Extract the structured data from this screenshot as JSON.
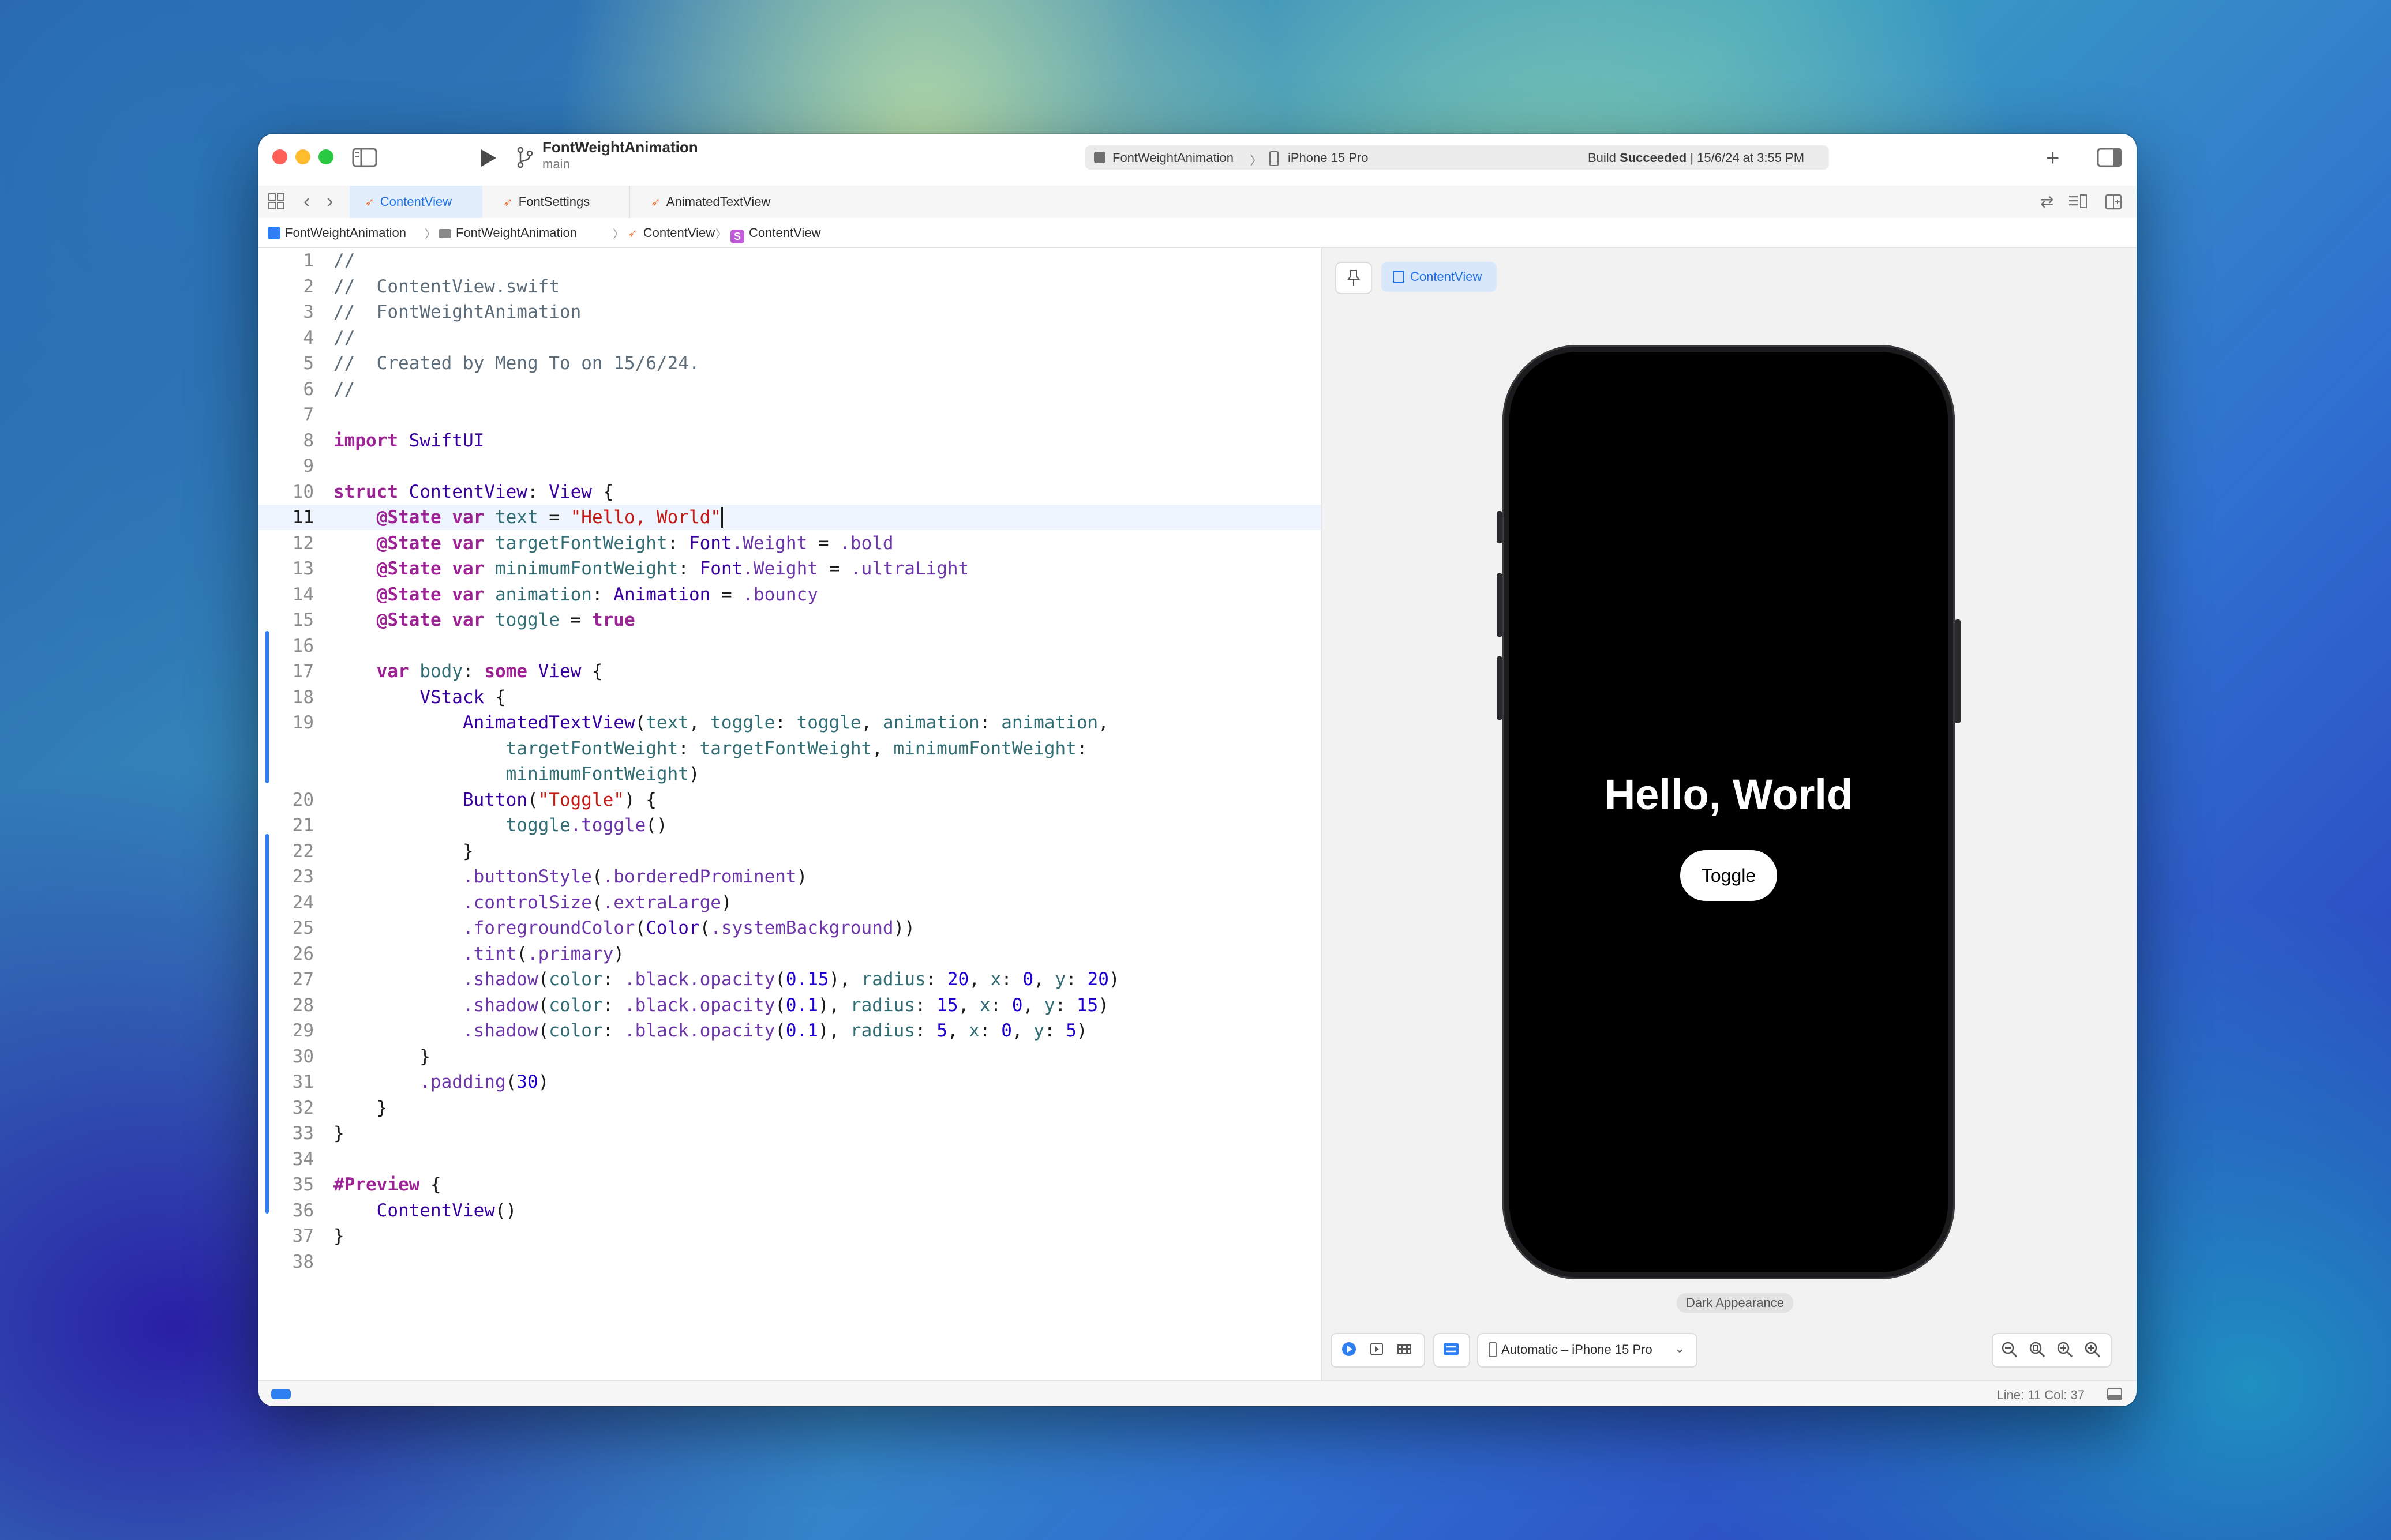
{
  "toolbar": {
    "project_name": "FontWeightAnimation",
    "branch": "main",
    "scheme": "FontWeightAnimation",
    "scheme_separator": "〉",
    "destination": "iPhone 15 Pro",
    "status_prefix": "Build ",
    "status_result": "Succeeded",
    "status_time": " | 15/6/24 at 3:55 PM"
  },
  "tabs": [
    {
      "label": "ContentView",
      "active": true
    },
    {
      "label": "FontSettings",
      "active": false
    },
    {
      "label": "AnimatedTextView",
      "active": false
    }
  ],
  "breadcrumb": [
    "FontWeightAnimation",
    "FontWeightAnimation",
    "ContentView",
    "ContentView"
  ],
  "breadcrumb_separator": "〉",
  "editor": {
    "current_line": 11,
    "lines": [
      {
        "n": "1",
        "code": "//"
      },
      {
        "n": "2",
        "code": "//  ContentView.swift"
      },
      {
        "n": "3",
        "code": "//  FontWeightAnimation"
      },
      {
        "n": "4",
        "code": "//"
      },
      {
        "n": "5",
        "code": "//  Created by Meng To on 15/6/24."
      },
      {
        "n": "6",
        "code": "//"
      },
      {
        "n": "7",
        "code": ""
      },
      {
        "n": "8",
        "code": "import SwiftUI"
      },
      {
        "n": "9",
        "code": ""
      },
      {
        "n": "10",
        "code": "struct ContentView: View {"
      },
      {
        "n": "11",
        "code": "    @State var text = \"Hello, World\""
      },
      {
        "n": "12",
        "code": "    @State var targetFontWeight: Font.Weight = .bold"
      },
      {
        "n": "13",
        "code": "    @State var minimumFontWeight: Font.Weight = .ultraLight"
      },
      {
        "n": "14",
        "code": "    @State var animation: Animation = .bouncy"
      },
      {
        "n": "15",
        "code": "    @State var toggle = true"
      },
      {
        "n": "16",
        "code": ""
      },
      {
        "n": "17",
        "code": "    var body: some View {"
      },
      {
        "n": "18",
        "code": "        VStack {"
      },
      {
        "n": "19",
        "code": "            AnimatedTextView(text, toggle: toggle, animation: animation,"
      },
      {
        "n": "",
        "code": "                targetFontWeight: targetFontWeight, minimumFontWeight:"
      },
      {
        "n": "",
        "code": "                minimumFontWeight)"
      },
      {
        "n": "20",
        "code": "            Button(\"Toggle\") {"
      },
      {
        "n": "21",
        "code": "                toggle.toggle()"
      },
      {
        "n": "22",
        "code": "            }"
      },
      {
        "n": "23",
        "code": "            .buttonStyle(.borderedProminent)"
      },
      {
        "n": "24",
        "code": "            .controlSize(.extraLarge)"
      },
      {
        "n": "25",
        "code": "            .foregroundColor(Color(.systemBackground))"
      },
      {
        "n": "26",
        "code": "            .tint(.primary)"
      },
      {
        "n": "27",
        "code": "            .shadow(color: .black.opacity(0.15), radius: 20, x: 0, y: 20)"
      },
      {
        "n": "28",
        "code": "            .shadow(color: .black.opacity(0.1), radius: 15, x: 0, y: 15)"
      },
      {
        "n": "29",
        "code": "            .shadow(color: .black.opacity(0.1), radius: 5, x: 0, y: 5)"
      },
      {
        "n": "30",
        "code": "        }"
      },
      {
        "n": "31",
        "code": "        .padding(30)"
      },
      {
        "n": "32",
        "code": "    }"
      },
      {
        "n": "33",
        "code": "}"
      },
      {
        "n": "34",
        "code": ""
      },
      {
        "n": "35",
        "code": "#Preview {"
      },
      {
        "n": "36",
        "code": "    ContentView()"
      },
      {
        "n": "37",
        "code": "}"
      },
      {
        "n": "38",
        "code": ""
      }
    ]
  },
  "preview": {
    "chip_label": "ContentView",
    "hello_text": "Hello, World",
    "toggle_label": "Toggle",
    "appearance_label": "Dark Appearance",
    "device_menu": "Automatic – iPhone 15 Pro"
  },
  "statusbar": {
    "position": "Line: 11  Col: 37"
  },
  "colors": {
    "accent": "#1f6fe0",
    "keyword": "#9b2393",
    "string": "#c41a16",
    "number": "#1c00cf",
    "comment": "#5d6c79"
  },
  "icons": {
    "run": "play-icon",
    "branch": "branch-icon",
    "sidebar": "sidebar-toggle-icon",
    "add": "plus-icon",
    "inspector": "inspector-toggle-icon"
  }
}
